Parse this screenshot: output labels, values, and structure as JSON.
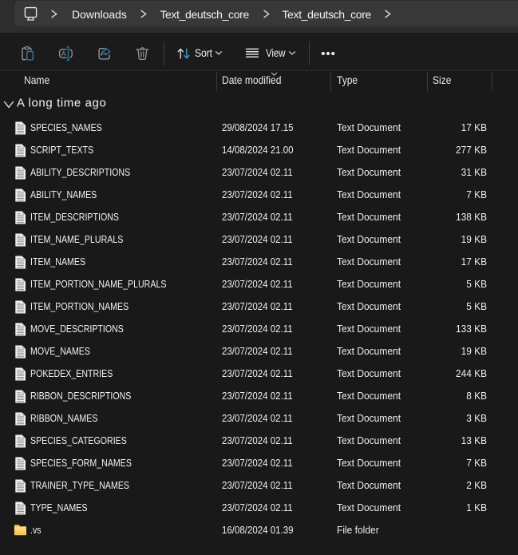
{
  "breadcrumb": {
    "root_icon": "this-pc-monitor-icon",
    "items": [
      "Downloads",
      "Text_deutsch_core",
      "Text_deutsch_core"
    ]
  },
  "toolbar": {
    "buttons": [
      "paste",
      "rename",
      "share",
      "delete"
    ],
    "sort_label": "Sort",
    "view_label": "View",
    "more_label": "see-more"
  },
  "columns": {
    "name": "Name",
    "date_modified": "Date modified",
    "type": "Type",
    "size": "Size",
    "sort_column": "Date modified",
    "sort_direction": "descending"
  },
  "group": {
    "label": "A long time ago",
    "expanded": true
  },
  "files": {
    "rows": [
      {
        "name": "SPECIES_NAMES",
        "date": "29/08/2024 17.15",
        "type": "Text Document",
        "size": "17 KB",
        "icon": "text"
      },
      {
        "name": "SCRIPT_TEXTS",
        "date": "14/08/2024 21.00",
        "type": "Text Document",
        "size": "277 KB",
        "icon": "text"
      },
      {
        "name": "ABILITY_DESCRIPTIONS",
        "date": "23/07/2024 02.11",
        "type": "Text Document",
        "size": "31 KB",
        "icon": "text"
      },
      {
        "name": "ABILITY_NAMES",
        "date": "23/07/2024 02.11",
        "type": "Text Document",
        "size": "7 KB",
        "icon": "text"
      },
      {
        "name": "ITEM_DESCRIPTIONS",
        "date": "23/07/2024 02.11",
        "type": "Text Document",
        "size": "138 KB",
        "icon": "text"
      },
      {
        "name": "ITEM_NAME_PLURALS",
        "date": "23/07/2024 02.11",
        "type": "Text Document",
        "size": "19 KB",
        "icon": "text"
      },
      {
        "name": "ITEM_NAMES",
        "date": "23/07/2024 02.11",
        "type": "Text Document",
        "size": "17 KB",
        "icon": "text"
      },
      {
        "name": "ITEM_PORTION_NAME_PLURALS",
        "date": "23/07/2024 02.11",
        "type": "Text Document",
        "size": "5 KB",
        "icon": "text"
      },
      {
        "name": "ITEM_PORTION_NAMES",
        "date": "23/07/2024 02.11",
        "type": "Text Document",
        "size": "5 KB",
        "icon": "text"
      },
      {
        "name": "MOVE_DESCRIPTIONS",
        "date": "23/07/2024 02.11",
        "type": "Text Document",
        "size": "133 KB",
        "icon": "text"
      },
      {
        "name": "MOVE_NAMES",
        "date": "23/07/2024 02.11",
        "type": "Text Document",
        "size": "19 KB",
        "icon": "text"
      },
      {
        "name": "POKEDEX_ENTRIES",
        "date": "23/07/2024 02.11",
        "type": "Text Document",
        "size": "244 KB",
        "icon": "text"
      },
      {
        "name": "RIBBON_DESCRIPTIONS",
        "date": "23/07/2024 02.11",
        "type": "Text Document",
        "size": "8 KB",
        "icon": "text"
      },
      {
        "name": "RIBBON_NAMES",
        "date": "23/07/2024 02.11",
        "type": "Text Document",
        "size": "3 KB",
        "icon": "text"
      },
      {
        "name": "SPECIES_CATEGORIES",
        "date": "23/07/2024 02.11",
        "type": "Text Document",
        "size": "13 KB",
        "icon": "text"
      },
      {
        "name": "SPECIES_FORM_NAMES",
        "date": "23/07/2024 02.11",
        "type": "Text Document",
        "size": "7 KB",
        "icon": "text"
      },
      {
        "name": "TRAINER_TYPE_NAMES",
        "date": "23/07/2024 02.11",
        "type": "Text Document",
        "size": "2 KB",
        "icon": "text"
      },
      {
        "name": "TYPE_NAMES",
        "date": "23/07/2024 02.11",
        "type": "Text Document",
        "size": "1 KB",
        "icon": "text"
      },
      {
        "name": ".vs",
        "date": "16/08/2024 01.39",
        "type": "File folder",
        "size": "",
        "icon": "folder"
      }
    ]
  },
  "colors": {
    "window_bar": "#2d2d2d",
    "address_field": "#383838",
    "toolbar_bg": "#1b1b1b",
    "content_bg": "#191919",
    "text_primary": "#f1f1f1",
    "accent_blue": "#42a0d9",
    "disabled_blue": "#3d7fa8",
    "icon_gray": "#9c9c9c",
    "folder_yellow": "#f7cb4f"
  }
}
